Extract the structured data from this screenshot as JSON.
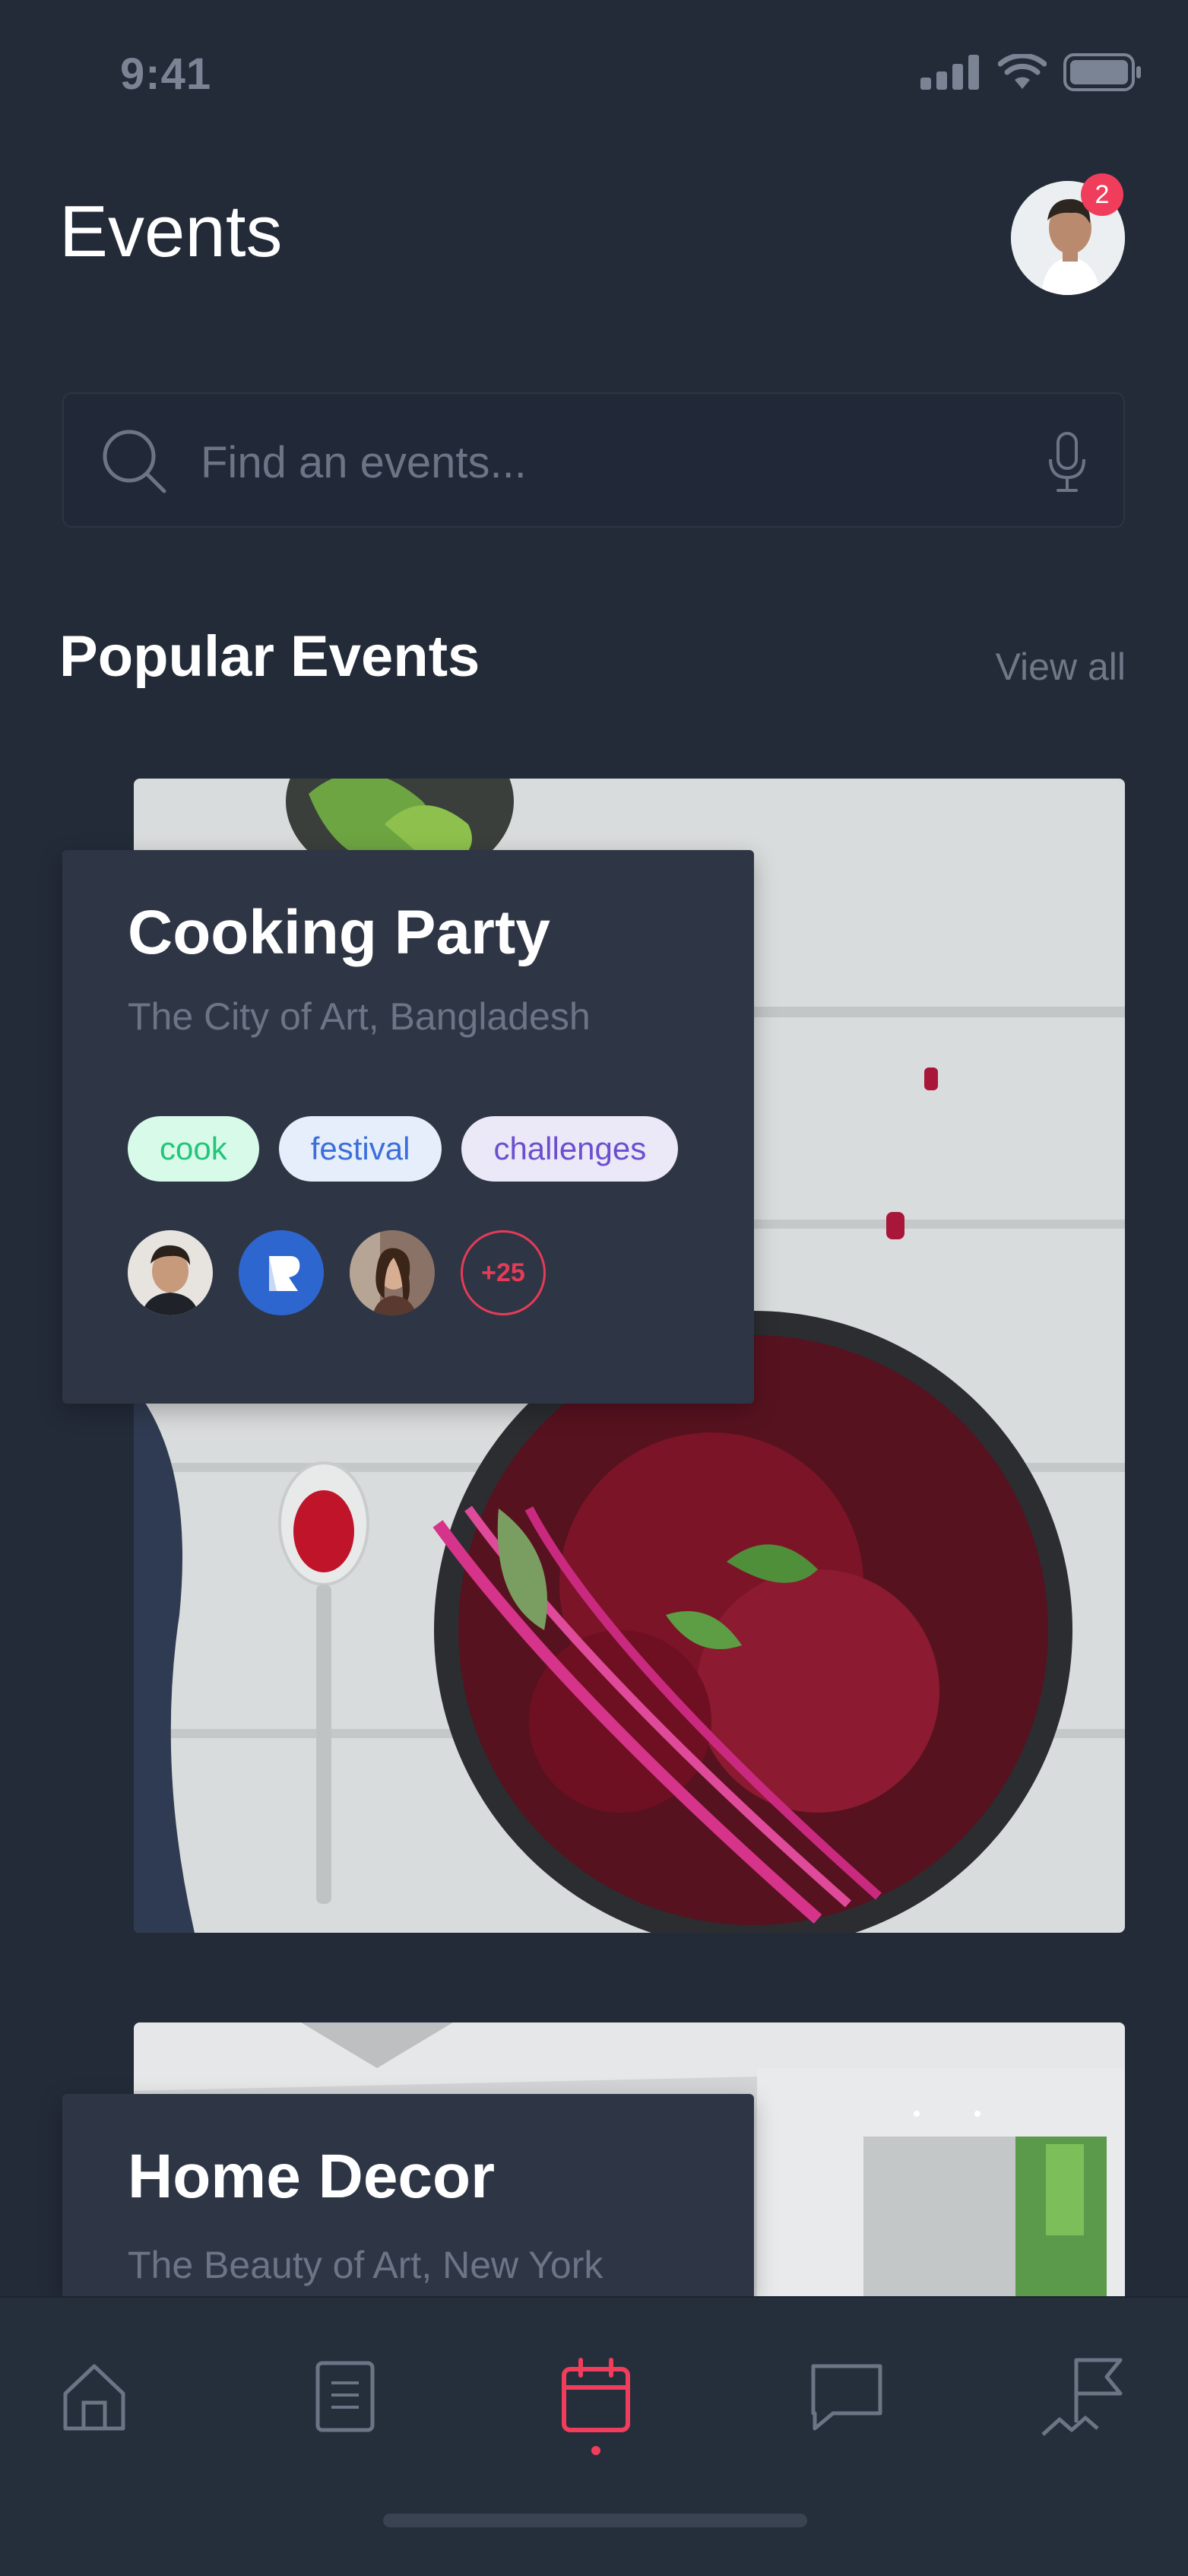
{
  "status_bar": {
    "time": "9:41"
  },
  "header": {
    "title": "Events",
    "notification_count": "2"
  },
  "search": {
    "placeholder": "Find an events..."
  },
  "popular": {
    "title": "Popular Events",
    "view_all": "View all",
    "events": [
      {
        "title": "Cooking Party",
        "location": "The City of Art, Bangladesh",
        "tags": [
          "cook",
          "festival",
          "challenges"
        ],
        "extra_attendees": "+25"
      },
      {
        "title": "Home Decor",
        "location": "The Beauty of Art, New York"
      }
    ]
  },
  "nav": {
    "items": [
      "home-icon",
      "document-icon",
      "calendar-icon",
      "chat-icon",
      "flag-icon"
    ],
    "active": "calendar-icon"
  },
  "colors": {
    "background": "#232b38",
    "card": "#2e3646",
    "accent": "#f13d5c"
  }
}
